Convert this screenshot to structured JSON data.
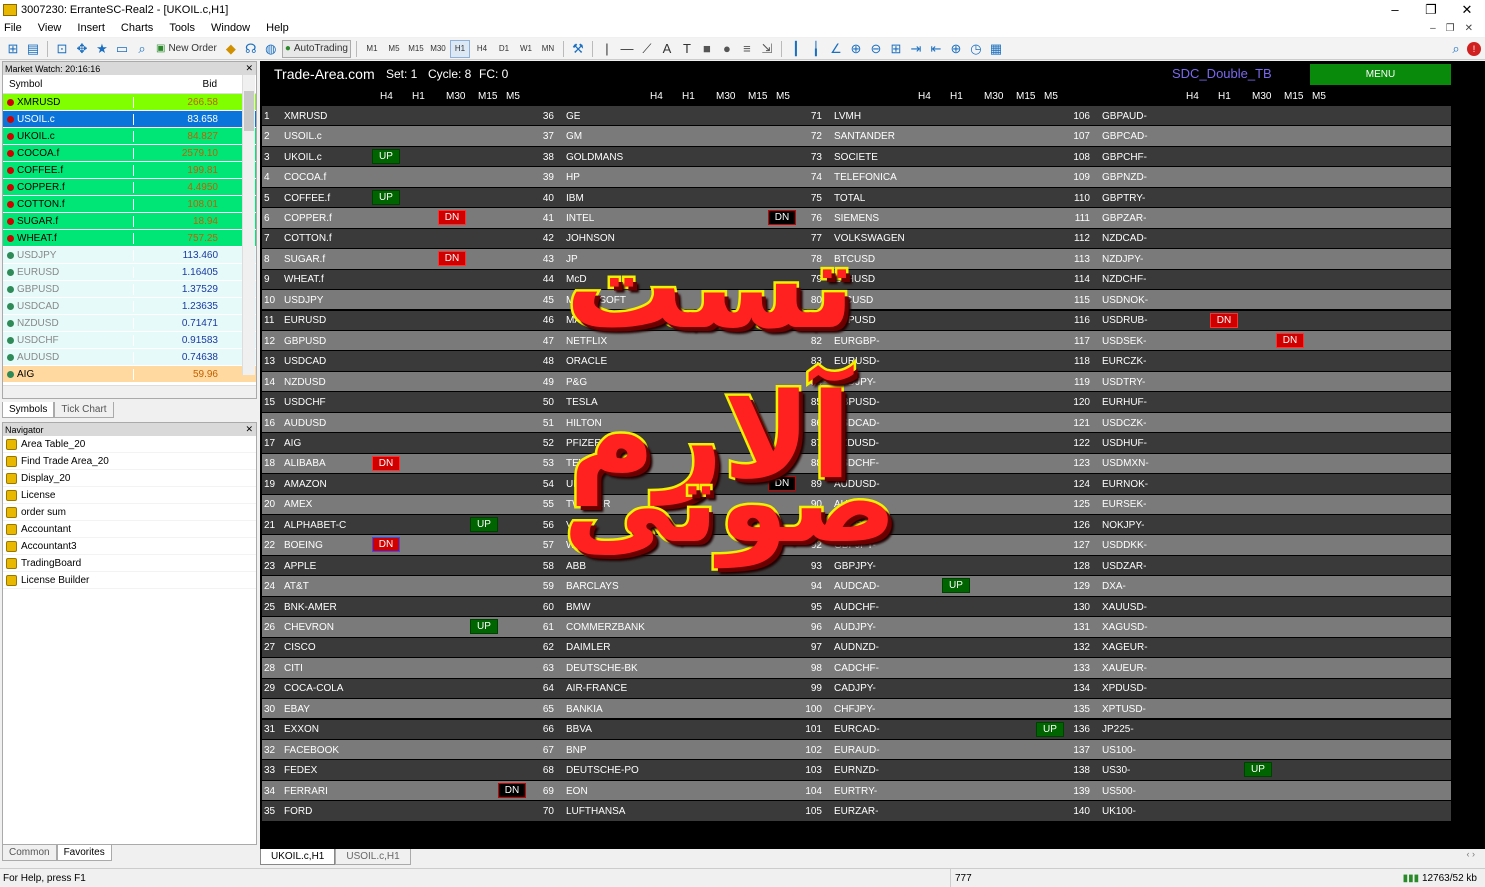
{
  "window": {
    "title": "3007230: ErranteSC-Real2 - [UKOIL.c,H1]"
  },
  "menu": [
    "File",
    "View",
    "Insert",
    "Charts",
    "Tools",
    "Window",
    "Help"
  ],
  "toolbar": {
    "new_order": "New Order",
    "autotrading": "AutoTrading",
    "timeframes": [
      "M1",
      "M5",
      "M15",
      "M30",
      "H1",
      "H4",
      "D1",
      "W1",
      "MN"
    ],
    "active_tf": "H1"
  },
  "market_watch": {
    "header": "Market Watch: 20:16:16",
    "col_symbol": "Symbol",
    "col_bid": "Bid",
    "rows": [
      {
        "symbol": "XMRUSD",
        "bid": "266.58",
        "bg": "#7fff00",
        "dot": "#d00000"
      },
      {
        "symbol": "USOIL.c",
        "bid": "83.658",
        "bg": "#0a74da",
        "dot": "#d00000",
        "selected": true
      },
      {
        "symbol": "UKOIL.c",
        "bid": "84.827",
        "bg": "#00e676",
        "dot": "#d00000"
      },
      {
        "symbol": "COCOA.f",
        "bid": "2579.10",
        "bg": "#00e676",
        "dot": "#d00000"
      },
      {
        "symbol": "COFFEE.f",
        "bid": "199.81",
        "bg": "#00e676",
        "dot": "#d00000"
      },
      {
        "symbol": "COPPER.f",
        "bid": "4.4950",
        "bg": "#00e676",
        "dot": "#d00000"
      },
      {
        "symbol": "COTTON.f",
        "bid": "108.01",
        "bg": "#00e676",
        "dot": "#d00000"
      },
      {
        "symbol": "SUGAR.f",
        "bid": "18.94",
        "bg": "#00e676",
        "dot": "#d00000"
      },
      {
        "symbol": "WHEAT.f",
        "bid": "757.25",
        "bg": "#00e676",
        "dot": "#d00000"
      },
      {
        "symbol": "USDJPY",
        "bid": "113.460",
        "bg": "#e6fafa",
        "dot": "#2e8b57",
        "dim": true
      },
      {
        "symbol": "EURUSD",
        "bid": "1.16405",
        "bg": "#e6fafa",
        "dot": "#2e8b57",
        "dim": true
      },
      {
        "symbol": "GBPUSD",
        "bid": "1.37529",
        "bg": "#e6fafa",
        "dot": "#2e8b57",
        "dim": true
      },
      {
        "symbol": "USDCAD",
        "bid": "1.23635",
        "bg": "#e6fafa",
        "dot": "#2e8b57",
        "dim": true
      },
      {
        "symbol": "NZDUSD",
        "bid": "0.71471",
        "bg": "#e6fafa",
        "dot": "#2e8b57",
        "dim": true
      },
      {
        "symbol": "USDCHF",
        "bid": "0.91583",
        "bg": "#e6fafa",
        "dot": "#2e8b57",
        "dim": true
      },
      {
        "symbol": "AUDUSD",
        "bid": "0.74638",
        "bg": "#e6fafa",
        "dot": "#2e8b57",
        "dim": true
      },
      {
        "symbol": "AIG",
        "bid": "59.96",
        "bg": "#ffd9a0",
        "dot": "#2e8b57"
      }
    ],
    "tabs": [
      "Symbols",
      "Tick Chart"
    ]
  },
  "navigator": {
    "header": "Navigator",
    "items": [
      "Area Table_20",
      "Find Trade Area_20",
      "Display_20",
      "License",
      "order sum",
      "Accountant",
      "Accountant3",
      "TradingBoard",
      "License Builder"
    ],
    "tabs": [
      "Common",
      "Favorites"
    ]
  },
  "dashboard": {
    "brand": "Trade-Area.com",
    "set": "Set: 1",
    "cycle": "Cycle: 8",
    "fc": "FC: 0",
    "indicator": "SDC_Double_TB",
    "menu_button": "MENU",
    "tf_headers": [
      "H4",
      "H1",
      "M30",
      "M15",
      "M5"
    ],
    "columns": [
      [
        "XMRUSD",
        "USOIL.c",
        "UKOIL.c",
        "COCOA.f",
        "COFFEE.f",
        "COPPER.f",
        "COTTON.f",
        "SUGAR.f",
        "WHEAT.f",
        "USDJPY",
        "EURUSD",
        "GBPUSD",
        "USDCAD",
        "NZDUSD",
        "USDCHF",
        "AUDUSD",
        "AIG",
        "ALIBABA",
        "AMAZON",
        "AMEX",
        "ALPHABET-C",
        "BOEING",
        "APPLE",
        "AT&T",
        "BNK-AMER",
        "CHEVRON",
        "CISCO",
        "CITI",
        "COCA-COLA",
        "EBAY",
        "EXXON",
        "FACEBOOK",
        "FEDEX",
        "FERRARI",
        "FORD"
      ],
      [
        "GE",
        "GM",
        "GOLDMANS",
        "HP",
        "IBM",
        "INTEL",
        "JOHNSON",
        "JP",
        "McD",
        "MICROSOFT",
        "MASTERCARD",
        "NETFLIX",
        "ORACLE",
        "P&G",
        "TESLA",
        "HILTON",
        "PFIZER",
        "TEVA",
        "UBER",
        "TWITTER",
        "VISA",
        "WALMART",
        "ABB",
        "BARCLAYS",
        "BMW",
        "COMMERZBANK",
        "DAIMLER",
        "DEUTSCHE-BK",
        "AIR-FRANCE",
        "BANKIA",
        "BBVA",
        "BNP",
        "DEUTSCHE-PO",
        "EON",
        "LUFTHANSA"
      ],
      [
        "LVMH",
        "SANTANDER",
        "SOCIETE",
        "TELEFONICA",
        "TOTAL",
        "SIEMENS",
        "VOLKSWAGEN",
        "BTCUSD",
        "ETHUSD",
        "LTCUSD",
        "XRPUSD",
        "EURGBP-",
        "EURUSD-",
        "USDJPY-",
        "GBPUSD-",
        "USDCAD-",
        "NZDUSD-",
        "USDCHF-",
        "AUDUSD-",
        "AUDNZD-",
        "AUDCAD-",
        "GBPJPY-",
        "GBPJPY-",
        "AUDCAD-",
        "AUDCHF-",
        "AUDJPY-",
        "AUDNZD-",
        "CADCHF-",
        "CADJPY-",
        "CHFJPY-",
        "EURCAD-",
        "EURAUD-",
        "EURNZD-",
        "EURTRY-",
        "EURZAR-"
      ],
      [
        "GBPAUD-",
        "GBPCAD-",
        "GBPCHF-",
        "GBPNZD-",
        "GBPTRY-",
        "GBPZAR-",
        "NZDCAD-",
        "NZDJPY-",
        "NZDCHF-",
        "USDNOK-",
        "USDRUB-",
        "USDSEK-",
        "EURCZK-",
        "USDTRY-",
        "EURHUF-",
        "USDCZK-",
        "USDHUF-",
        "USDMXN-",
        "EURNOK-",
        "EURSEK-",
        "NOKJPY-",
        "USDDKK-",
        "USDZAR-",
        "DXA-",
        "XAUUSD-",
        "XAGUSD-",
        "XAGEUR-",
        "XAUEUR-",
        "XPDUSD-",
        "XPTUSD-",
        "JP225-",
        "US100-",
        "US30-",
        "US500-",
        "UK100-"
      ]
    ],
    "signals": [
      {
        "col": 0,
        "row": 2,
        "tf": 0,
        "label": "UP",
        "kind": "up"
      },
      {
        "col": 0,
        "row": 4,
        "tf": 0,
        "label": "UP",
        "kind": "up"
      },
      {
        "col": 0,
        "row": 5,
        "tf": 2,
        "label": "DN",
        "kind": "dn"
      },
      {
        "col": 0,
        "row": 7,
        "tf": 2,
        "label": "DN",
        "kind": "dn"
      },
      {
        "col": 0,
        "row": 17,
        "tf": 0,
        "label": "DN",
        "kind": "dn"
      },
      {
        "col": 0,
        "row": 20,
        "tf": 3,
        "label": "UP",
        "kind": "up"
      },
      {
        "col": 0,
        "row": 21,
        "tf": 0,
        "label": "DN",
        "kind": "dnb"
      },
      {
        "col": 0,
        "row": 25,
        "tf": 3,
        "label": "UP",
        "kind": "up"
      },
      {
        "col": 0,
        "row": 33,
        "tf": 4,
        "label": "DN",
        "kind": "dnk"
      },
      {
        "col": 1,
        "row": 5,
        "tf": 4,
        "label": "DN",
        "kind": "dnk"
      },
      {
        "col": 1,
        "row": 18,
        "tf": 4,
        "label": "DN",
        "kind": "dnk"
      },
      {
        "col": 2,
        "row": 23,
        "tf": 1,
        "label": "UP",
        "kind": "up"
      },
      {
        "col": 2,
        "row": 30,
        "tf": 4,
        "label": "UP",
        "kind": "up"
      },
      {
        "col": 3,
        "row": 10,
        "tf": 1,
        "label": "DN",
        "kind": "dn"
      },
      {
        "col": 3,
        "row": 11,
        "tf": 3,
        "label": "DN",
        "kind": "dn"
      },
      {
        "col": 3,
        "row": 32,
        "tf": 2,
        "label": "UP",
        "kind": "up"
      }
    ],
    "overlay_line1": "تست آلارم",
    "overlay_line2": "صوتی"
  },
  "chart_tabs": [
    "UKOIL.c,H1",
    "USOIL.c,H1"
  ],
  "status": {
    "help": "For Help, press F1",
    "bars": "777",
    "traffic": "12763/52 kb"
  }
}
